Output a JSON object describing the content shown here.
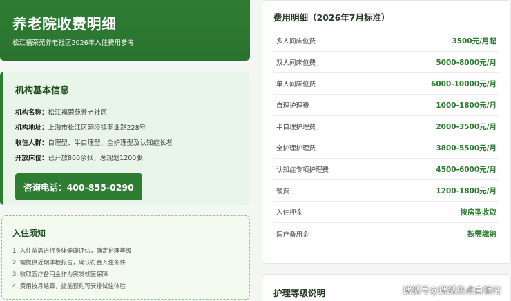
{
  "hero": {
    "title": "养老院收费明细",
    "subtitle": "松江福荣苑养老社区2026年入住费用参考"
  },
  "info": {
    "title": "机构基本信息",
    "rows": [
      {
        "label": "机构名称：",
        "value": "松江福荣苑养老社区"
      },
      {
        "label": "机构地址：",
        "value": "上海市松江区洞泾镇洞业路228号"
      },
      {
        "label": "收住人群：",
        "value": "自理型、半自理型、全护理型及认知症长者"
      },
      {
        "label": "开放床位：",
        "value": "已开放800余张，总规划1200张"
      }
    ],
    "phone": "咨询电话：400-855-0290"
  },
  "notice": {
    "title": "入住须知",
    "items": [
      "1. 入住前需进行身体健康评估，确定护理等级",
      "2. 需提供近期体检报告，确认符合入住条件",
      "3. 收取医疗备用金作为突发就医保障",
      "4. 费用按月结算，提前预约可安排试住体验"
    ]
  },
  "fees": {
    "title": "费用明细（2026年7月标准）",
    "rows": [
      {
        "name": "多人间床位费",
        "price": "3500元/月起"
      },
      {
        "name": "双人间床位费",
        "price": "5000-8000元/月"
      },
      {
        "name": "单人间床位费",
        "price": "6000-10000元/月"
      },
      {
        "name": "自理护理费",
        "price": "1000-1800元/月"
      },
      {
        "name": "半自理护理费",
        "price": "2000-3500元/月"
      },
      {
        "name": "全护理护理费",
        "price": "3800-5500元/月"
      },
      {
        "name": "认知症专项护理费",
        "price": "4500-6000元/月"
      },
      {
        "name": "餐费",
        "price": "1200-1800元/月"
      },
      {
        "name": "入住押金",
        "price": "按房型收取"
      },
      {
        "name": "医疗备用金",
        "price": "按需缴纳"
      }
    ]
  },
  "levels": {
    "title": "护理等级说明"
  },
  "watermark": "搜狐号@搜狐焦点白银站",
  "colors": {
    "brand": "#2e7d32",
    "price": "#2e7d32",
    "info_bg": "#eaf5ea"
  }
}
